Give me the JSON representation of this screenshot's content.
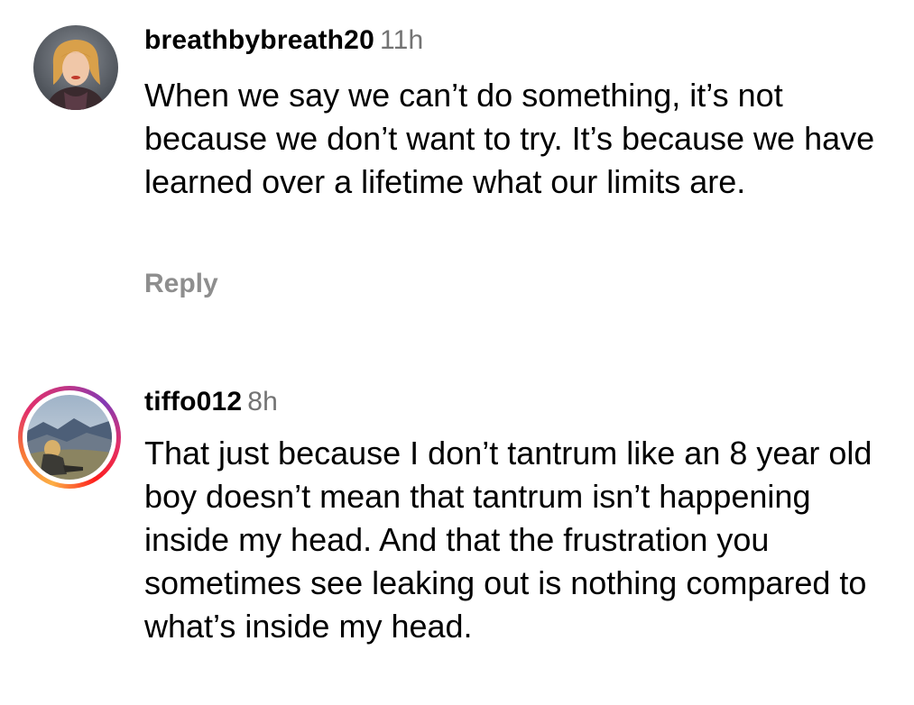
{
  "comments": [
    {
      "username": "breathbybreath20",
      "time": "11h",
      "text": "When we say we can’t do something, it’s not because we don’t want to try. It’s because we have learned over a lifetime what our limits are.",
      "reply_label": "Reply"
    },
    {
      "username": "tiffo012",
      "time": "8h",
      "text": "That just because I don’t tantrum like an 8 year old boy doesn’t mean that tantrum isn’t happening inside my head. And that the frustration you sometimes see leaking out is nothing compared to what’s inside my head."
    }
  ],
  "colors": {
    "timestamp": "#737373",
    "reply": "#8e8e8e",
    "story_ring": [
      "#fcaf45",
      "#e1306c",
      "#833ab4"
    ]
  }
}
